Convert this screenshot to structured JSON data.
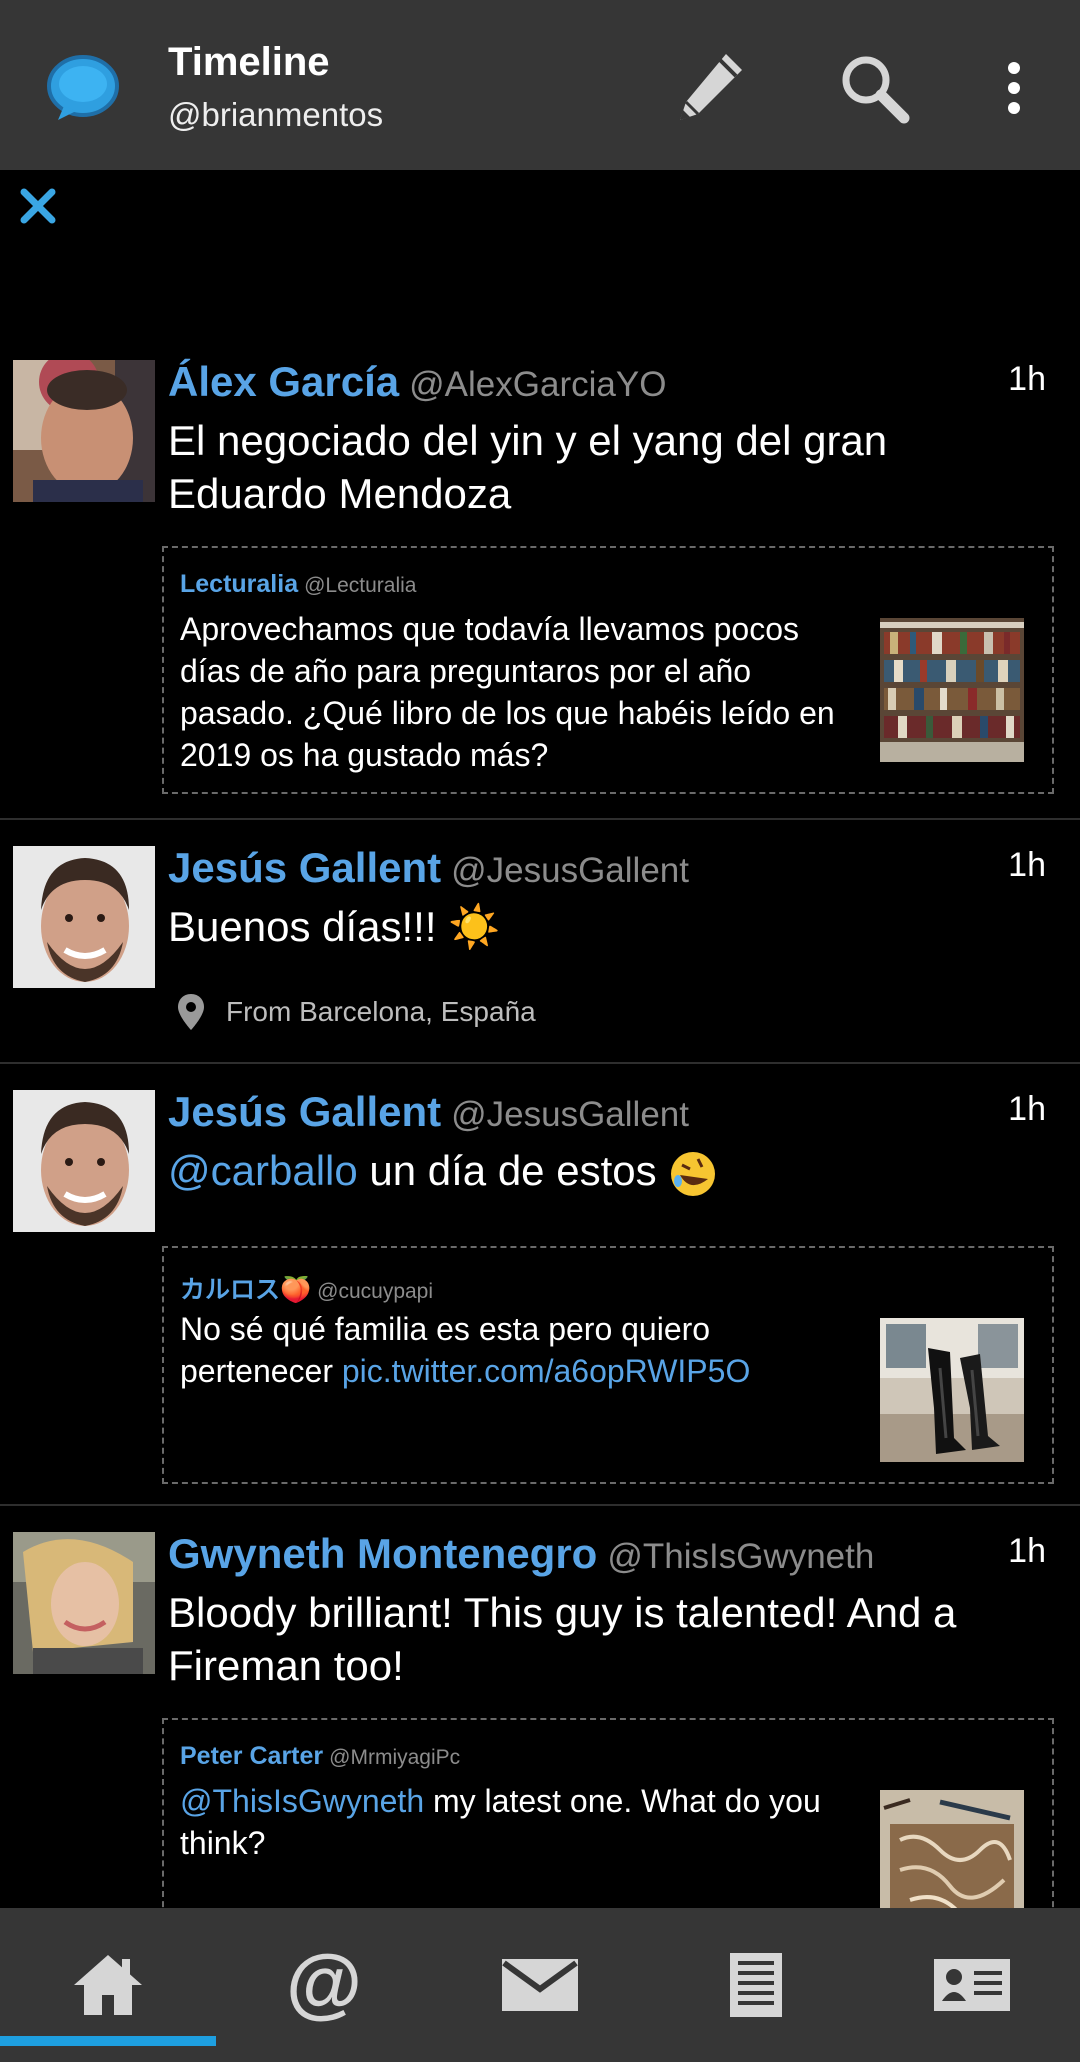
{
  "header": {
    "title": "Timeline",
    "account": "@brianmentos",
    "actions": [
      "pencil-icon",
      "search-icon",
      "overflow-menu-icon"
    ]
  },
  "tweets": [
    {
      "name": "Álex García",
      "handle": "@AlexGarciaYO",
      "time": "1h",
      "text": "El negociado del yin y el yang del gran Eduardo Mendoza",
      "quote": {
        "name": "Lecturalia",
        "handle": "@Lecturalia",
        "text": "Aprovechamos que todavía llevamos pocos días de año para preguntaros por el año pasado. ¿Qué libro de los que habéis leído en 2019 os ha gustado más?"
      }
    },
    {
      "name": "Jesús Gallent",
      "handle": "@JesusGallent",
      "time": "1h",
      "text": "Buenos días!!! ☀️",
      "location": "From Barcelona, España"
    },
    {
      "name": "Jesús Gallent",
      "handle": "@JesusGallent",
      "time": "1h",
      "mention": "@carballo",
      "text": " un día de estos",
      "quote": {
        "name": "カルロス🍑",
        "handle": "@cucuypapi",
        "text": "No sé qué familia es esta pero quiero pertenecer ",
        "link": "pic.twitter.com/a6opRWIP5O"
      }
    },
    {
      "name": "Gwyneth Montenegro",
      "handle": "@ThisIsGwyneth",
      "time": "1h",
      "text": "Bloody brilliant! This guy is talented! And a Fireman too!",
      "quote": {
        "name": "Peter Carter",
        "handle": "@MrmiyagiPc",
        "mention": "@ThisIsGwyneth",
        "text": " my latest one. What do you think?"
      }
    }
  ],
  "bottom_nav": {
    "items": [
      "home-icon",
      "mentions-icon",
      "messages-icon",
      "lists-icon",
      "profile-icon"
    ],
    "selected": "home-icon"
  },
  "colors": {
    "accent": "#59a4e6",
    "indicator": "#1e9fe0",
    "bar_background": "#363636",
    "background": "#000000"
  }
}
